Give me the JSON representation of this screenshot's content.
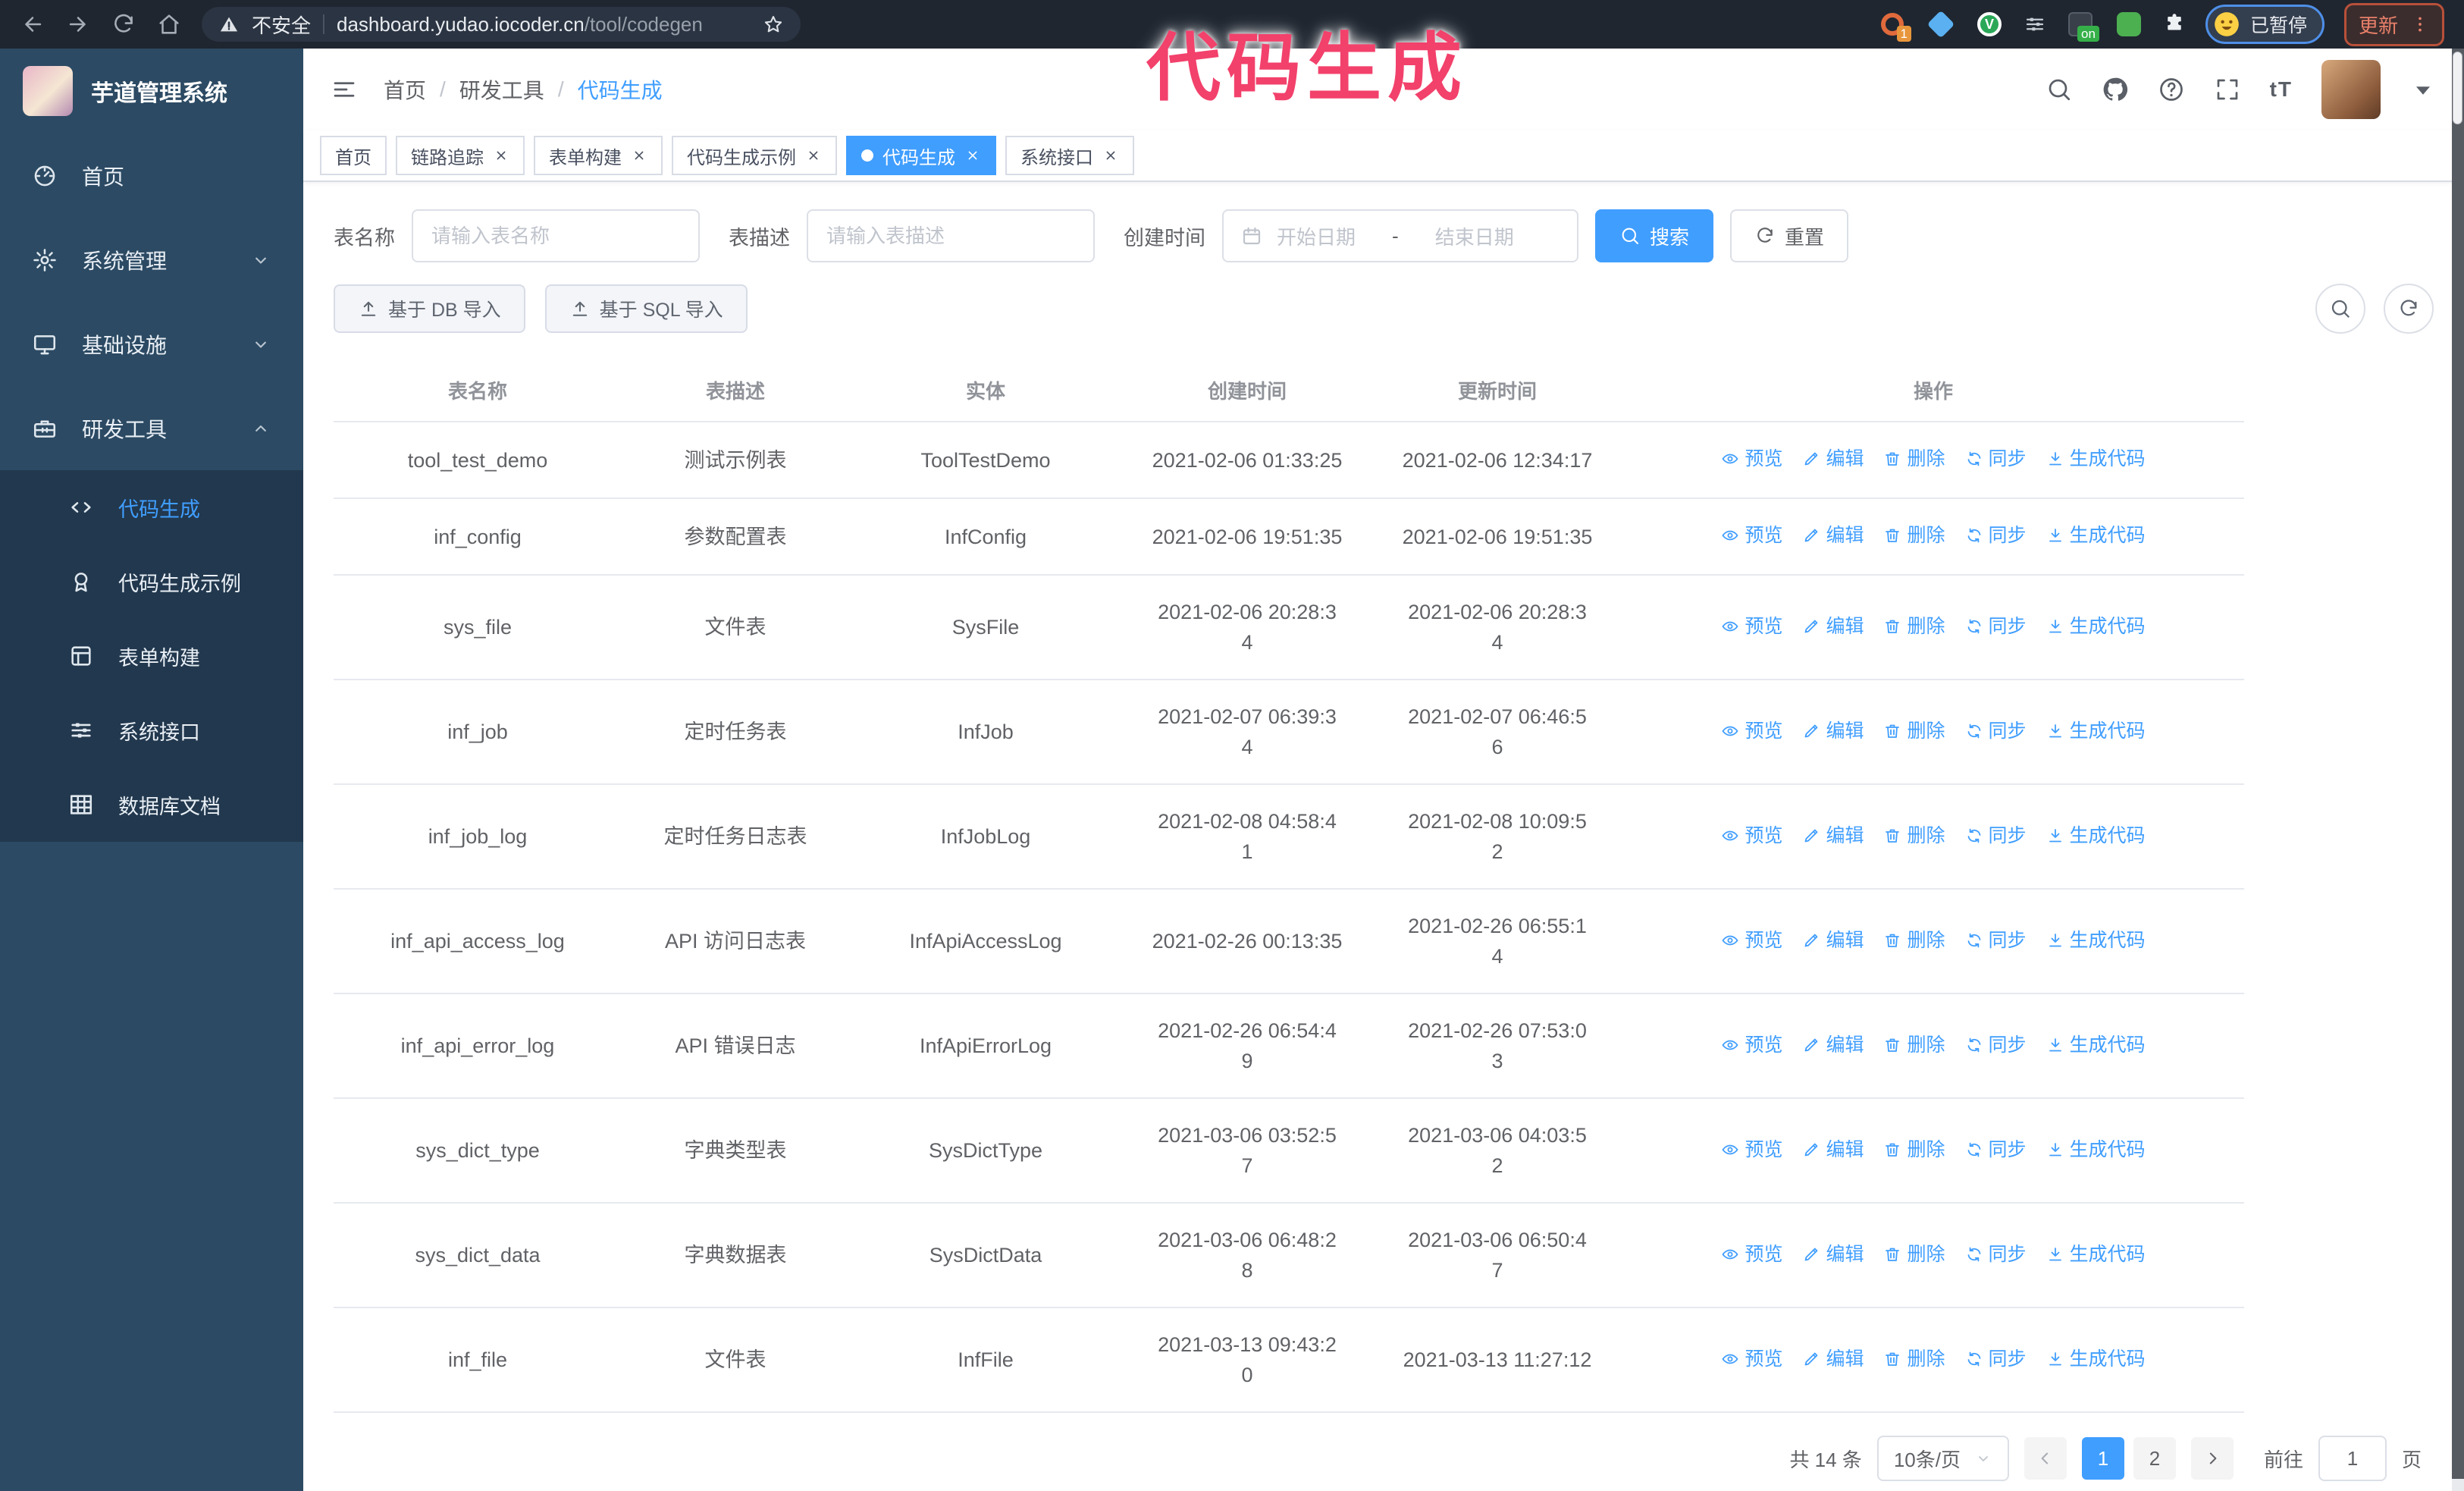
{
  "browser": {
    "security_label": "不安全",
    "url_host": "dashboard.yudao.iocoder.cn",
    "url_path": "/tool/codegen",
    "ext_badge_count": "1",
    "ext_badge_on": "on",
    "profile_status": "已暂停",
    "update_label": "更新"
  },
  "annotation": {
    "text": "代码生成"
  },
  "app": {
    "title": "芋道管理系统"
  },
  "sidebar": {
    "items": [
      {
        "key": "home",
        "label": "首页",
        "icon": "dashboard-icon"
      },
      {
        "key": "system-admin",
        "label": "系统管理",
        "icon": "gear-icon",
        "chevron": "down"
      },
      {
        "key": "infrastructure",
        "label": "基础设施",
        "icon": "monitor-icon",
        "chevron": "down"
      },
      {
        "key": "dev-tools",
        "label": "研发工具",
        "icon": "toolbox-icon",
        "chevron": "up",
        "children": [
          {
            "key": "codegen",
            "label": "代码生成",
            "icon": "code-icon",
            "active": true
          },
          {
            "key": "codegen-example",
            "label": "代码生成示例",
            "icon": "badge-icon"
          },
          {
            "key": "form-builder",
            "label": "表单构建",
            "icon": "form-icon"
          },
          {
            "key": "system-api",
            "label": "系统接口",
            "icon": "sliders-icon"
          },
          {
            "key": "db-doc",
            "label": "数据库文档",
            "icon": "grid-icon"
          }
        ]
      }
    ]
  },
  "breadcrumb": [
    "首页",
    "研发工具",
    "代码生成"
  ],
  "tabs": [
    {
      "label": "首页",
      "closable": false,
      "active": false
    },
    {
      "label": "链路追踪",
      "closable": true,
      "active": false
    },
    {
      "label": "表单构建",
      "closable": true,
      "active": false
    },
    {
      "label": "代码生成示例",
      "closable": true,
      "active": false
    },
    {
      "label": "代码生成",
      "closable": true,
      "active": true
    },
    {
      "label": "系统接口",
      "closable": true,
      "active": false
    }
  ],
  "filters": {
    "table_name_label": "表名称",
    "table_name_placeholder": "请输入表名称",
    "table_desc_label": "表描述",
    "table_desc_placeholder": "请输入表描述",
    "create_time_label": "创建时间",
    "date_start_placeholder": "开始日期",
    "date_separator": "-",
    "date_end_placeholder": "结束日期",
    "search_label": "搜索",
    "reset_label": "重置"
  },
  "toolbar": {
    "import_db_label": "基于 DB 导入",
    "import_sql_label": "基于 SQL 导入"
  },
  "table": {
    "columns": [
      "表名称",
      "表描述",
      "实体",
      "创建时间",
      "更新时间",
      "操作"
    ],
    "action_labels": [
      "预览",
      "编辑",
      "删除",
      "同步",
      "生成代码"
    ],
    "rows": [
      {
        "name": "tool_test_demo",
        "desc": "测试示例表",
        "entity": "ToolTestDemo",
        "created": "2021-02-06 01:33:25",
        "updated": "2021-02-06 12:34:17"
      },
      {
        "name": "inf_config",
        "desc": "参数配置表",
        "entity": "InfConfig",
        "created": "2021-02-06 19:51:35",
        "updated": "2021-02-06 19:51:35"
      },
      {
        "name": "sys_file",
        "desc": "文件表",
        "entity": "SysFile",
        "created": "2021-02-06 20:28:3\n4",
        "updated": "2021-02-06 20:28:3\n4"
      },
      {
        "name": "inf_job",
        "desc": "定时任务表",
        "entity": "InfJob",
        "created": "2021-02-07 06:39:3\n4",
        "updated": "2021-02-07 06:46:5\n6"
      },
      {
        "name": "inf_job_log",
        "desc": "定时任务日志表",
        "entity": "InfJobLog",
        "created": "2021-02-08 04:58:4\n1",
        "updated": "2021-02-08 10:09:5\n2"
      },
      {
        "name": "inf_api_access_log",
        "desc": "API 访问日志表",
        "entity": "InfApiAccessLog",
        "created": "2021-02-26 00:13:35",
        "updated": "2021-02-26 06:55:1\n4"
      },
      {
        "name": "inf_api_error_log",
        "desc": "API 错误日志",
        "entity": "InfApiErrorLog",
        "created": "2021-02-26 06:54:4\n9",
        "updated": "2021-02-26 07:53:0\n3"
      },
      {
        "name": "sys_dict_type",
        "desc": "字典类型表",
        "entity": "SysDictType",
        "created": "2021-03-06 03:52:5\n7",
        "updated": "2021-03-06 04:03:5\n2"
      },
      {
        "name": "sys_dict_data",
        "desc": "字典数据表",
        "entity": "SysDictData",
        "created": "2021-03-06 06:48:2\n8",
        "updated": "2021-03-06 06:50:4\n7"
      },
      {
        "name": "inf_file",
        "desc": "文件表",
        "entity": "InfFile",
        "created": "2021-03-13 09:43:2\n0",
        "updated": "2021-03-13 11:27:12"
      }
    ]
  },
  "pagination": {
    "total": "共 14 条",
    "page_size": "10条/页",
    "pages": [
      "1",
      "2"
    ],
    "active_page": "1",
    "goto_label": "前往",
    "goto_value": "1",
    "unit_label": "页"
  },
  "colors": {
    "primary": "#409EFF",
    "sidebar_bg": "#2c4a63",
    "submenu_bg": "#22384e",
    "annotation": "#f2416b"
  }
}
